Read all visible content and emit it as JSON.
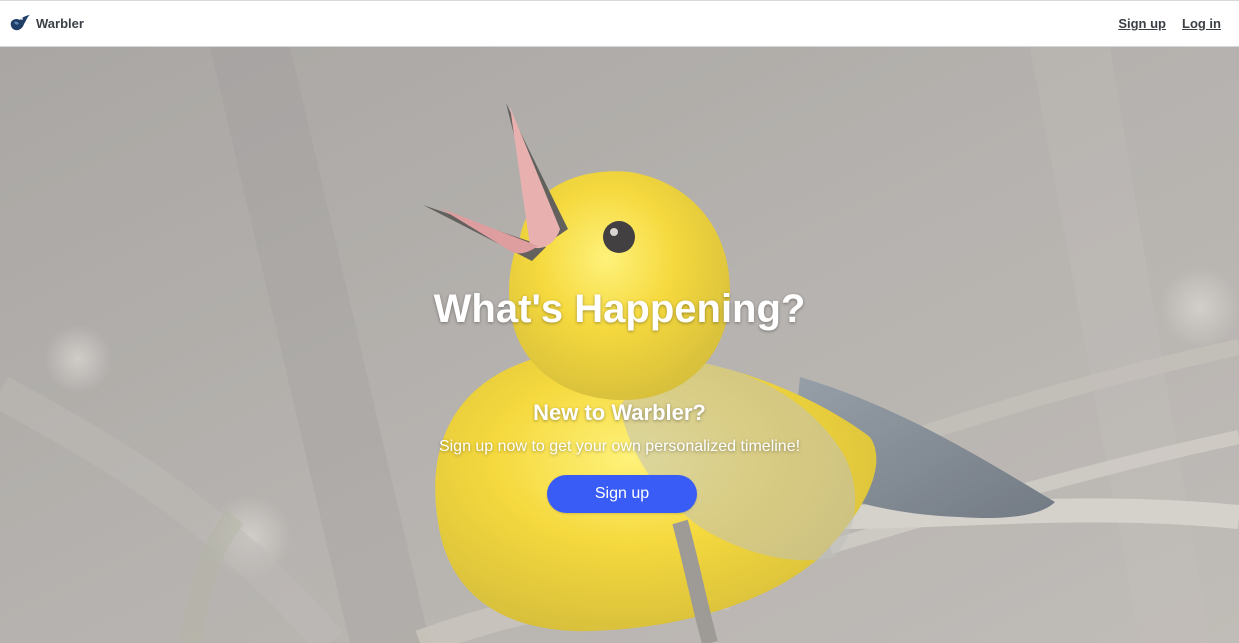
{
  "navbar": {
    "brand_name": "Warbler",
    "brand_icon": "warbler-bird-logo",
    "signup_label": "Sign up",
    "login_label": "Log in"
  },
  "hero": {
    "title": "What's Happening?",
    "subtitle": "New to Warbler?",
    "text": "Sign up now to get your own personalized timeline!",
    "button_label": "Sign up",
    "background": "yellow-warbler-bird-photo"
  },
  "colors": {
    "nav_text": "#3b4046",
    "button": "#3a5cf6",
    "hero_text": "#ffffff",
    "bird_yellow": "#f2d31f",
    "background_gray": "#a39f9b"
  }
}
